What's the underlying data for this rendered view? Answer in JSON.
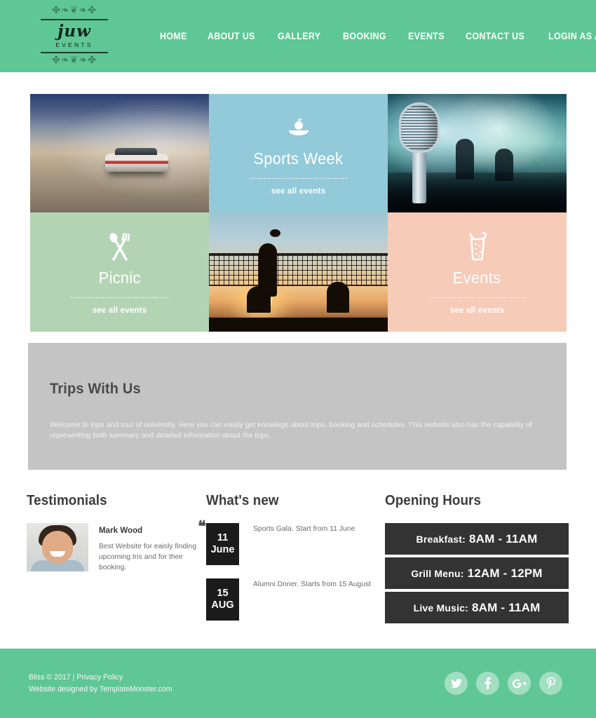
{
  "header": {
    "logo": {
      "name": "juw",
      "subtitle": "EVENTS",
      "flourish_top": "✤❧❦❧✤",
      "flourish_bottom": "✤❧❦❧✤"
    },
    "nav": [
      {
        "label": "HOME"
      },
      {
        "label": "ABOUT US"
      },
      {
        "label": "GALLERY"
      },
      {
        "label": "BOOKING"
      },
      {
        "label": "EVENTS"
      },
      {
        "label": "CONTACT US"
      },
      {
        "label": "LOGIN AS ADMIN"
      }
    ],
    "background_color": "#5fc795"
  },
  "tiles": [
    {
      "kind": "photo",
      "photo": "road-trip-convertible-car"
    },
    {
      "kind": "color",
      "title": "Sports Week",
      "link": "see all events",
      "icon": "apple-on-plate-icon",
      "color": "#92cada"
    },
    {
      "kind": "photo",
      "photo": "vintage-microphone-concert"
    },
    {
      "kind": "color",
      "title": "Picnic",
      "link": "see all events",
      "icon": "spoon-and-fork-icon",
      "color": "#b3d4b3"
    },
    {
      "kind": "photo",
      "photo": "beach-volleyball-sunset"
    },
    {
      "kind": "color",
      "title": "Events",
      "link": "see all events",
      "icon": "drink-glass-icon",
      "color": "#f6cbb8"
    }
  ],
  "trips": {
    "title": "Trips With Us",
    "text": "Welcome to trips and tour of university. Here you can easily get knowlege about trips, booking and schedules. This website also has the capability of representing both summary and detailed information about the trips.",
    "background_color": "#c4c4c4"
  },
  "testimonials": {
    "title": "Testimonials",
    "quote_mark": "❝",
    "items": [
      {
        "name": "Mark Wood",
        "text": "Best Website for eaisly finding upcoming tris and for their booking.",
        "avatar": "man-smiling-avatar"
      }
    ]
  },
  "whats_new": {
    "title": "What's new",
    "items": [
      {
        "day": "11",
        "month": "June",
        "text": "Sports Gala. Start from 11 June"
      },
      {
        "day": "15",
        "month": "AUG",
        "text": "Alumni Dnner. Starts from 15 August"
      }
    ]
  },
  "opening_hours": {
    "title": "Opening Hours",
    "rows": [
      {
        "label": "Breakfast:",
        "value": "8AM - 11AM"
      },
      {
        "label": "Grill Menu:",
        "value": "12AM - 12PM"
      },
      {
        "label": "Live Music:",
        "value": "8AM - 11AM"
      }
    ],
    "row_color": "#333333"
  },
  "footer": {
    "copyright": "Bliss © 2017  |  ",
    "privacy_label": "Privacy Policy",
    "credit": "Website designed by TemplateMonster.com",
    "socials": [
      {
        "name": "twitter-icon"
      },
      {
        "name": "facebook-icon"
      },
      {
        "name": "google-plus-icon"
      },
      {
        "name": "pinterest-icon"
      }
    ],
    "background_color": "#5fc795"
  }
}
